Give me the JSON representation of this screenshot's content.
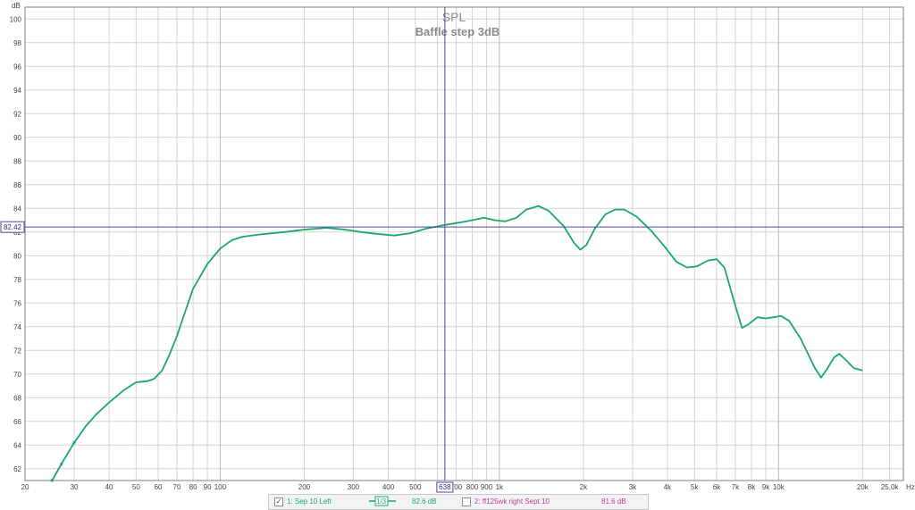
{
  "chart_data": {
    "type": "line",
    "title": "SPL",
    "subtitle": "Baffle step 3dB",
    "y_unit": "dB",
    "x_unit": "Hz",
    "x_scale": "log",
    "xlim": [
      20,
      28000
    ],
    "ylim": [
      61,
      101
    ],
    "grid": true,
    "y_ticks": [
      62,
      64,
      66,
      68,
      70,
      72,
      74,
      76,
      78,
      80,
      82,
      84,
      86,
      88,
      90,
      92,
      94,
      96,
      98,
      100
    ],
    "x_ticks": [
      {
        "v": 20,
        "label": "20"
      },
      {
        "v": 30,
        "label": "30"
      },
      {
        "v": 40,
        "label": "40"
      },
      {
        "v": 50,
        "label": "50"
      },
      {
        "v": 60,
        "label": "60"
      },
      {
        "v": 70,
        "label": "70"
      },
      {
        "v": 80,
        "label": "80"
      },
      {
        "v": 90,
        "label": "90"
      },
      {
        "v": 100,
        "label": "100"
      },
      {
        "v": 200,
        "label": "200"
      },
      {
        "v": 300,
        "label": "300"
      },
      {
        "v": 400,
        "label": "400"
      },
      {
        "v": 500,
        "label": "500"
      },
      {
        "v": 700,
        "label": "700"
      },
      {
        "v": 800,
        "label": "800"
      },
      {
        "v": 900,
        "label": "900"
      },
      {
        "v": 1000,
        "label": "1k"
      },
      {
        "v": 2000,
        "label": "2k"
      },
      {
        "v": 3000,
        "label": "3k"
      },
      {
        "v": 4000,
        "label": "4k"
      },
      {
        "v": 5000,
        "label": "5k"
      },
      {
        "v": 6000,
        "label": "6k"
      },
      {
        "v": 7000,
        "label": "7k"
      },
      {
        "v": 8000,
        "label": "8k"
      },
      {
        "v": 9000,
        "label": "9k"
      },
      {
        "v": 10000,
        "label": "10k"
      },
      {
        "v": 20000,
        "label": "20k"
      },
      {
        "v": 25000,
        "label": "25.0k"
      }
    ],
    "x_minor": [
      600,
      30000
    ],
    "cursor": {
      "x": 638,
      "x_label": "638",
      "y": 82.42,
      "y_label": "82.42"
    },
    "series": [
      {
        "name": "1: Sep 10 Left",
        "color": "#1aa86a",
        "points": [
          [
            25,
            61
          ],
          [
            27,
            62.4
          ],
          [
            30,
            64.2
          ],
          [
            33,
            65.6
          ],
          [
            36,
            66.6
          ],
          [
            40,
            67.6
          ],
          [
            45,
            68.6
          ],
          [
            50,
            69.3
          ],
          [
            55,
            69.4
          ],
          [
            58,
            69.6
          ],
          [
            62,
            70.3
          ],
          [
            66,
            71.7
          ],
          [
            70,
            73.2
          ],
          [
            75,
            75.3
          ],
          [
            80,
            77.2
          ],
          [
            90,
            79.3
          ],
          [
            100,
            80.6
          ],
          [
            110,
            81.3
          ],
          [
            120,
            81.6
          ],
          [
            140,
            81.8
          ],
          [
            170,
            82.0
          ],
          [
            200,
            82.2
          ],
          [
            240,
            82.35
          ],
          [
            280,
            82.2
          ],
          [
            320,
            82.0
          ],
          [
            360,
            81.85
          ],
          [
            420,
            81.7
          ],
          [
            480,
            81.9
          ],
          [
            550,
            82.3
          ],
          [
            640,
            82.6
          ],
          [
            720,
            82.8
          ],
          [
            800,
            83.0
          ],
          [
            880,
            83.2
          ],
          [
            960,
            83.0
          ],
          [
            1050,
            82.9
          ],
          [
            1150,
            83.2
          ],
          [
            1250,
            83.9
          ],
          [
            1380,
            84.2
          ],
          [
            1500,
            83.8
          ],
          [
            1700,
            82.5
          ],
          [
            1850,
            81.1
          ],
          [
            1950,
            80.5
          ],
          [
            2050,
            80.9
          ],
          [
            2200,
            82.3
          ],
          [
            2400,
            83.5
          ],
          [
            2600,
            83.9
          ],
          [
            2800,
            83.9
          ],
          [
            3100,
            83.3
          ],
          [
            3500,
            82.1
          ],
          [
            3900,
            80.8
          ],
          [
            4300,
            79.5
          ],
          [
            4700,
            79.0
          ],
          [
            5100,
            79.1
          ],
          [
            5600,
            79.6
          ],
          [
            6000,
            79.7
          ],
          [
            6400,
            79.0
          ],
          [
            6900,
            76.3
          ],
          [
            7400,
            73.9
          ],
          [
            7800,
            74.2
          ],
          [
            8400,
            74.8
          ],
          [
            9000,
            74.7
          ],
          [
            9600,
            74.8
          ],
          [
            10200,
            74.9
          ],
          [
            10900,
            74.5
          ],
          [
            12000,
            73.0
          ],
          [
            13500,
            70.5
          ],
          [
            14200,
            69.7
          ],
          [
            14900,
            70.4
          ],
          [
            15800,
            71.4
          ],
          [
            16500,
            71.7
          ],
          [
            17400,
            71.2
          ],
          [
            18600,
            70.5
          ],
          [
            20000,
            70.3
          ]
        ],
        "legend_value": "82.6 dB",
        "smoothing": "1/3",
        "checked": true
      }
    ],
    "legend": [
      {
        "label": "1: Sep 10 Left",
        "value": "82.6 dB",
        "color": "#1aa86a",
        "smoothing": "1/3",
        "checked": true
      },
      {
        "label": "2: ff125wk right Sept 10",
        "value": "81.6 dB",
        "color": "#c03a9a",
        "checked": false
      }
    ]
  }
}
